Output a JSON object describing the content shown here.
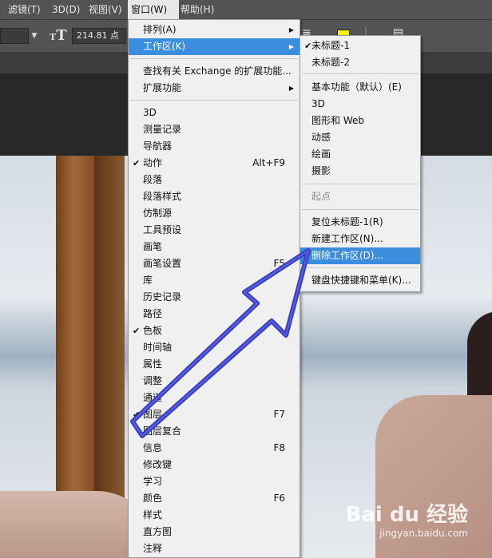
{
  "menubar": {
    "items": [
      "滤镜(T)",
      "3D(D)",
      "视图(V)",
      "窗口(W)",
      "帮助(H)"
    ]
  },
  "toolbar": {
    "font_size_value": "214.81 点",
    "text_tool_glyph": "T"
  },
  "window_menu": {
    "items": [
      {
        "label": "排列(A)",
        "submenu": true
      },
      {
        "label": "工作区(K)",
        "submenu": true
      },
      {
        "label": "查找有关 Exchange 的扩展功能...",
        "submenu": false
      },
      {
        "label": "扩展功能",
        "submenu": true
      },
      {
        "label": "3D"
      },
      {
        "label": "测量记录"
      },
      {
        "label": "导航器"
      },
      {
        "label": "动作",
        "checked": true,
        "shortcut": "Alt+F9"
      },
      {
        "label": "段落"
      },
      {
        "label": "段落样式"
      },
      {
        "label": "仿制源"
      },
      {
        "label": "工具预设"
      },
      {
        "label": "画笔"
      },
      {
        "label": "画笔设置",
        "shortcut": "F5"
      },
      {
        "label": "库"
      },
      {
        "label": "历史记录"
      },
      {
        "label": "路径"
      },
      {
        "label": "色板",
        "checked": true
      },
      {
        "label": "时间轴"
      },
      {
        "label": "属性"
      },
      {
        "label": "调整"
      },
      {
        "label": "通道"
      },
      {
        "label": "图层",
        "checked": true,
        "shortcut": "F7"
      },
      {
        "label": "图层复合"
      },
      {
        "label": "信息",
        "shortcut": "F8"
      },
      {
        "label": "修改键"
      },
      {
        "label": "学习"
      },
      {
        "label": "颜色",
        "shortcut": "F6"
      },
      {
        "label": "样式"
      },
      {
        "label": "直方图"
      },
      {
        "label": "注释"
      }
    ]
  },
  "workspace_menu": {
    "items": [
      {
        "label": "未标题-1",
        "checked": true
      },
      {
        "label": "未标题-2"
      },
      {
        "label": "基本功能（默认）(E)"
      },
      {
        "label": "3D"
      },
      {
        "label": "图形和 Web"
      },
      {
        "label": "动感"
      },
      {
        "label": "绘画"
      },
      {
        "label": "摄影"
      },
      {
        "label": "起点",
        "disabled": true
      },
      {
        "label": "复位未标题-1(R)"
      },
      {
        "label": "新建工作区(N)..."
      },
      {
        "label": "删除工作区(D)...",
        "highlighted": true
      },
      {
        "label": "键盘快捷键和菜单(K)..."
      }
    ]
  },
  "watermark": {
    "text": "Bai du 经验",
    "sub": "jingyan.baidu.com"
  },
  "colors": {
    "menubar_bg": "#535353",
    "menu_bg": "#f0f0f0",
    "highlight": "#3b8ede",
    "annotation_arrow": "#3a3fc0"
  }
}
